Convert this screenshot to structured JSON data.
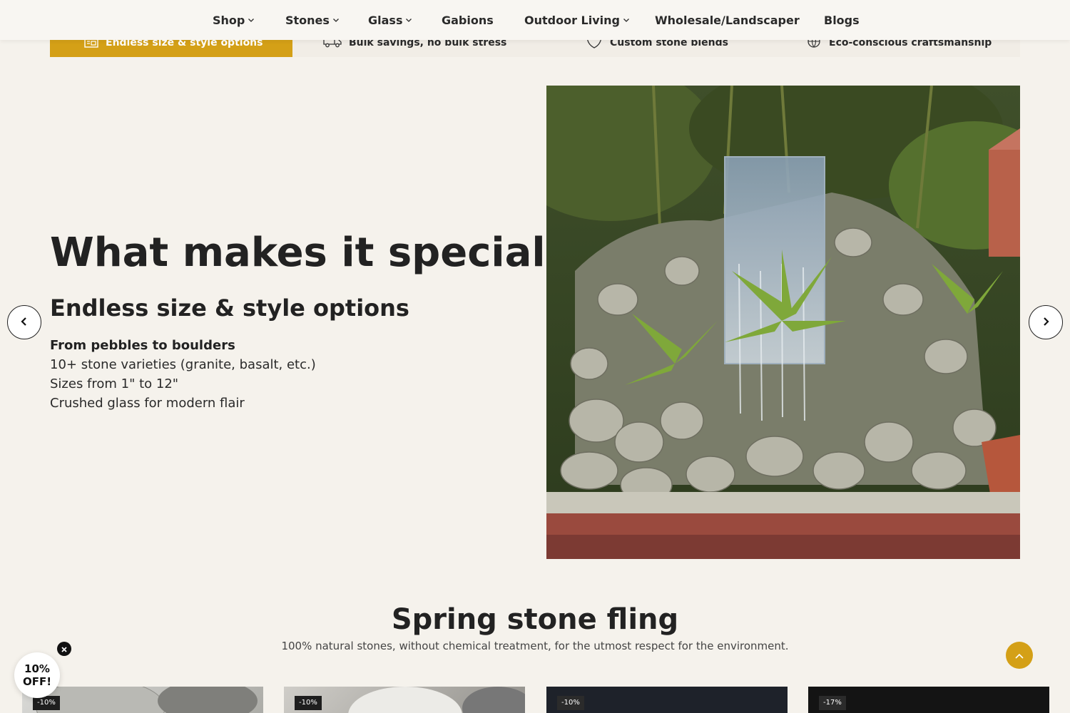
{
  "nav": {
    "items": [
      {
        "label": "Shop",
        "dropdown": true
      },
      {
        "label": "Stones",
        "dropdown": true
      },
      {
        "label": "Glass",
        "dropdown": true
      },
      {
        "label": "Gabions",
        "dropdown": false
      },
      {
        "label": "Outdoor Living",
        "dropdown": true
      },
      {
        "label": "Wholesale/Landscaper",
        "dropdown": false
      },
      {
        "label": "Blogs",
        "dropdown": false
      }
    ]
  },
  "feature_tabs": [
    {
      "label": "Endless size & style options",
      "icon": "ruler-box-icon",
      "active": true
    },
    {
      "label": "Bulk savings, no bulk stress",
      "icon": "truck-icon",
      "active": false
    },
    {
      "label": "Custom stone blends",
      "icon": "shield-icon",
      "active": false
    },
    {
      "label": "Eco-conscious craftsmanship",
      "icon": "eco-globe-icon",
      "active": false
    }
  ],
  "hero": {
    "title": "What makes it special?",
    "subtitle": "Endless size & style options",
    "lead": "From pebbles to boulders",
    "lines": [
      "10+ stone varieties (granite, basalt, etc.)",
      "Sizes from 1\" to 12\"",
      "Crushed glass for modern flair"
    ]
  },
  "section": {
    "title": "Spring stone fling",
    "subtitle": "100% natural stones, without chemical treatment, for the utmost respect for the environment."
  },
  "products": [
    {
      "badge": "-10%"
    },
    {
      "badge": "-10%"
    },
    {
      "badge": "-10%"
    },
    {
      "badge": "-17%"
    }
  ],
  "promo": {
    "line1": "10%",
    "line2": "OFF!"
  },
  "colors": {
    "accent": "#d4a017",
    "background": "#f5f2ec",
    "text": "#222222"
  }
}
